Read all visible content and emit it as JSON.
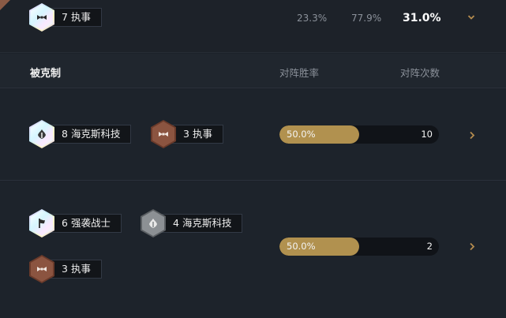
{
  "top_row": {
    "trait": {
      "count": "7",
      "name": "执事",
      "icon": "butler-bowtie-icon",
      "tier": "prismatic"
    },
    "stat_1": "23.3%",
    "stat_2": "77.9%",
    "stat_3": "31.0%"
  },
  "header": {
    "title": "被克制",
    "col_winrate": "对阵胜率",
    "col_games": "对阵次数"
  },
  "rows": [
    {
      "traits": [
        {
          "count": "8",
          "name": "海克斯科技",
          "icon": "hextech-emblem-icon",
          "tier": "prismatic"
        },
        {
          "count": "3",
          "name": "执事",
          "icon": "butler-bowtie-icon",
          "tier": "bronze"
        }
      ],
      "winrate": 50.0,
      "winrate_label": "50.0%",
      "games": "10"
    },
    {
      "traits": [
        {
          "count": "6",
          "name": "强袭战士",
          "icon": "bruiser-flag-icon",
          "tier": "prismatic"
        },
        {
          "count": "4",
          "name": "海克斯科技",
          "icon": "hextech-emblem-icon",
          "tier": "silver"
        },
        {
          "count": "3",
          "name": "执事",
          "icon": "butler-bowtie-icon",
          "tier": "bronze"
        }
      ],
      "winrate": 50.0,
      "winrate_label": "50.0%",
      "games": "2"
    }
  ],
  "colors": {
    "background": "#1c2129",
    "bar_fill": "#b1914f",
    "bar_track": "#101318",
    "accent_chevron": "#b58c4e",
    "bronze_tier": "#8b5440",
    "silver_tier": "#8c9094"
  }
}
